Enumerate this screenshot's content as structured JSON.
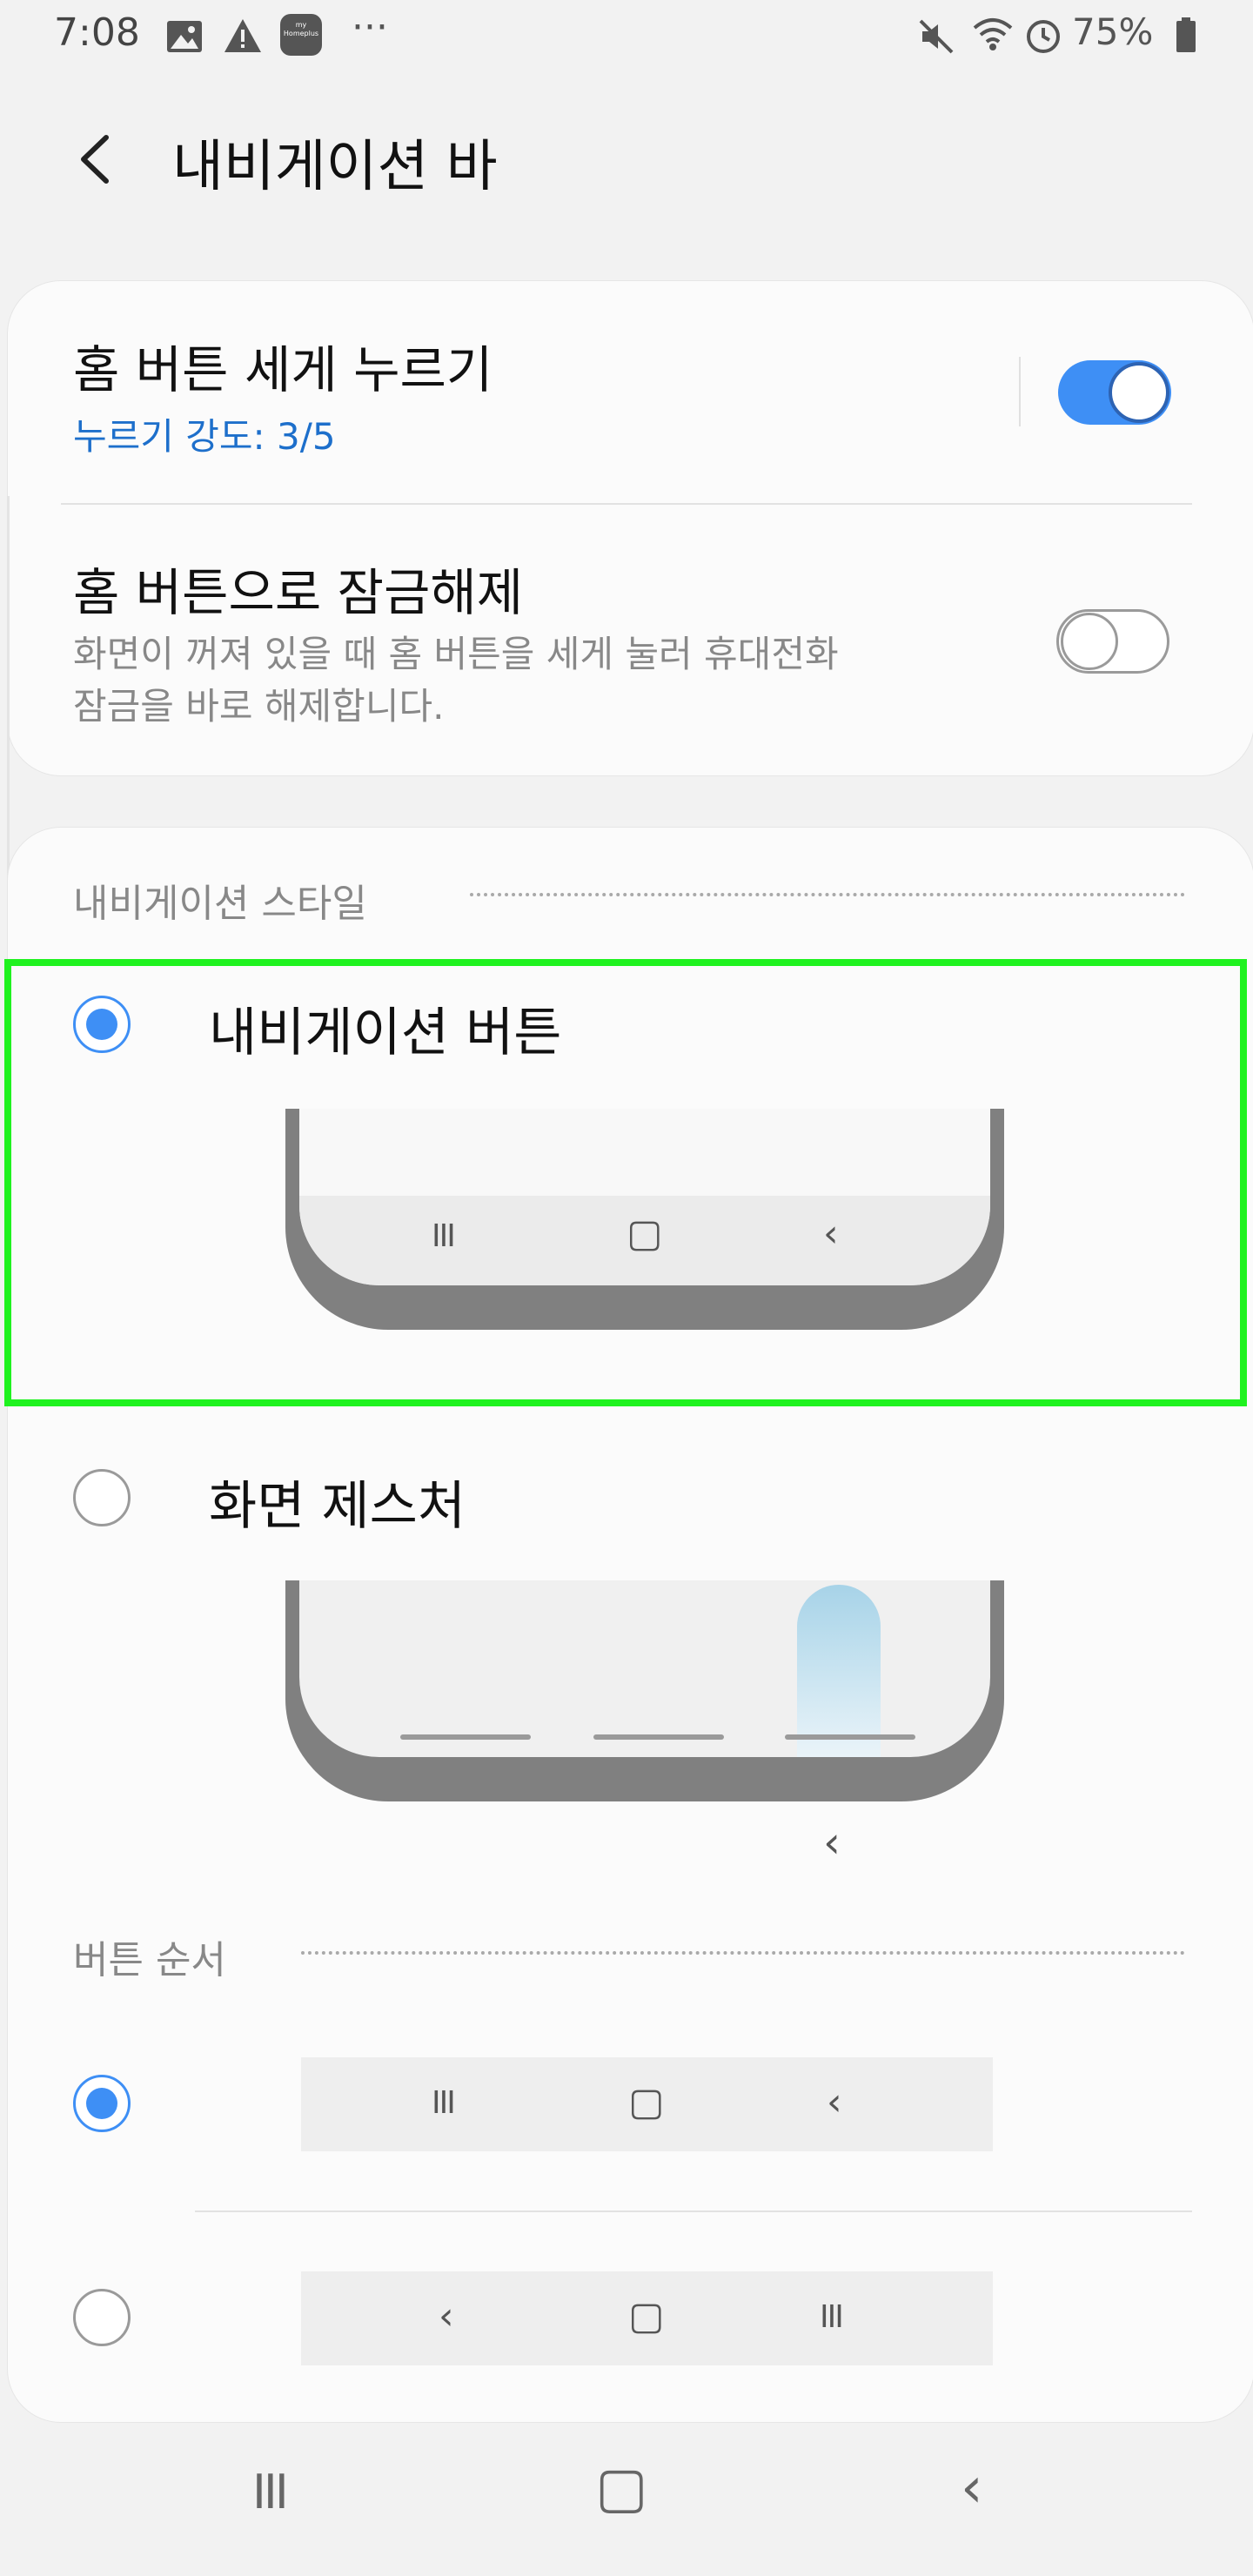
{
  "status_bar": {
    "time": "7:08",
    "left_icons": [
      "image-icon",
      "warning-icon",
      "my-homeplus-app-icon",
      "more-dots-icon"
    ],
    "app_icon_text": "my\nHomeplus",
    "more": "···",
    "battery": "75%",
    "right_icons": [
      "mute-icon",
      "wifi-icon",
      "alarm-icon",
      "battery-icon"
    ]
  },
  "header": {
    "back_glyph": "‹",
    "title": "내비게이션 바"
  },
  "card_home_button": {
    "press_hard": {
      "title": "홈 버튼 세게 누르기",
      "subtitle": "누르기 강도: 3/5",
      "enabled": true
    },
    "unlock": {
      "title": "홈 버튼으로 잠금해제",
      "description_line1": "화면이 꺼져 있을 때 홈 버튼을 세게 눌러 휴대전화",
      "description_line2": "잠금을 바로 해제합니다.",
      "enabled": false
    }
  },
  "navigation_style": {
    "section_header": "내비게이션 스타일",
    "options": [
      {
        "label": "내비게이션 버튼",
        "selected": true
      },
      {
        "label": "화면 제스처",
        "selected": false
      }
    ],
    "preview_glyphs": {
      "recents": "III",
      "home": "▢",
      "back": "‹"
    }
  },
  "button_order": {
    "section_header": "버튼 순서",
    "options": [
      {
        "glyphs": [
          "III",
          "▢",
          "‹"
        ],
        "selected": true
      },
      {
        "glyphs": [
          "‹",
          "▢",
          "III"
        ],
        "selected": false
      }
    ]
  },
  "system_nav": {
    "recents": "III",
    "home": "▢",
    "back": "‹"
  },
  "colors": {
    "accent": "#3e8ff5",
    "link_blue": "#1d6fcb",
    "focus_outline": "#1ff21f",
    "gesture_pill": "#a7d3e8"
  }
}
